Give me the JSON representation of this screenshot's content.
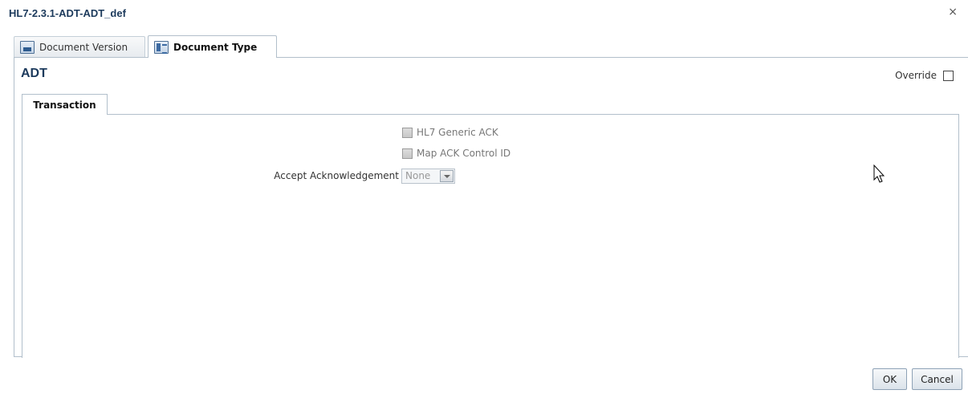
{
  "dialog": {
    "title": "HL7-2.3.1-ADT-ADT_def",
    "close_glyph": "×"
  },
  "tabs": [
    {
      "label": "Document Version",
      "icon": "document-version-icon",
      "active": false
    },
    {
      "label": "Document Type",
      "icon": "document-type-icon",
      "active": true
    }
  ],
  "section": {
    "title": "ADT",
    "override_label": "Override",
    "override_checked": false
  },
  "inner_tabs": [
    {
      "label": "Transaction",
      "active": true
    }
  ],
  "transaction": {
    "hl7_generic_ack_label": "HL7 Generic ACK",
    "hl7_generic_ack_enabled": false,
    "map_ack_control_id_label": "Map ACK Control ID",
    "map_ack_control_id_enabled": false,
    "accept_ack_label": "Accept Acknowledgement",
    "accept_ack_value": "None"
  },
  "footer": {
    "ok_label": "OK",
    "cancel_label": "Cancel"
  },
  "colors": {
    "title": "#1c3a5c",
    "border": "#b2bfcb"
  }
}
